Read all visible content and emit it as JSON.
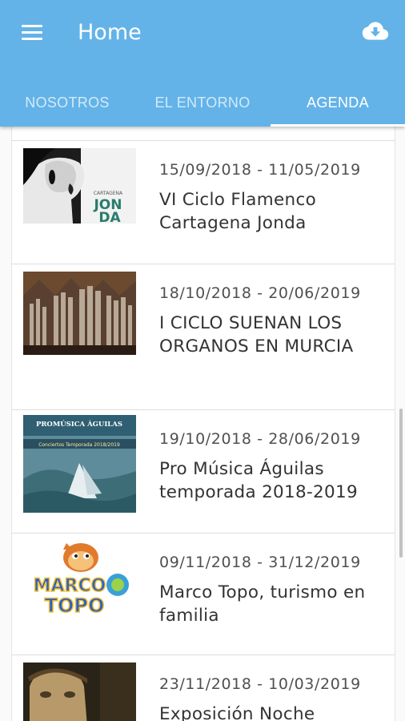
{
  "appbar": {
    "title": "Home",
    "menu_icon": "hamburger-menu-icon",
    "action_icon": "cloud-download-icon",
    "color": "#63b3e8"
  },
  "tabs": [
    {
      "label": "NOSOTROS",
      "active": false
    },
    {
      "label": "EL ENTORNO",
      "active": false
    },
    {
      "label": "AGENDA",
      "active": true
    }
  ],
  "events": [
    {
      "dates": "15/09/2018 - 11/05/2019",
      "title": "VI Ciclo Flamenco Cartagena Jonda",
      "image": "flamenco-singer-poster",
      "poster_text": [
        "CARTAGENA",
        "JON",
        "DA"
      ]
    },
    {
      "dates": "18/10/2018 - 20/06/2019",
      "title": "I CICLO SUENAN LOS ORGANOS EN MURCIA",
      "image": "church-organ-photo"
    },
    {
      "dates": "19/10/2018 - 28/06/2019",
      "title": "Pro Música Águilas temporada 2018-2019",
      "image": "seascape-poster",
      "poster_text": [
        "PROMÚSICA ÁGUILAS",
        "Conciertos Temporada 2018/2019"
      ]
    },
    {
      "dates": "09/11/2018 - 31/12/2019",
      "title": "Marco Topo, turismo en familia",
      "image": "marco-topo-logo",
      "poster_text": [
        "MARCO",
        "TOPO"
      ]
    },
    {
      "dates": "23/11/2018 - 10/03/2019",
      "title": "Exposición Noche",
      "image": "portrait-painting"
    }
  ]
}
